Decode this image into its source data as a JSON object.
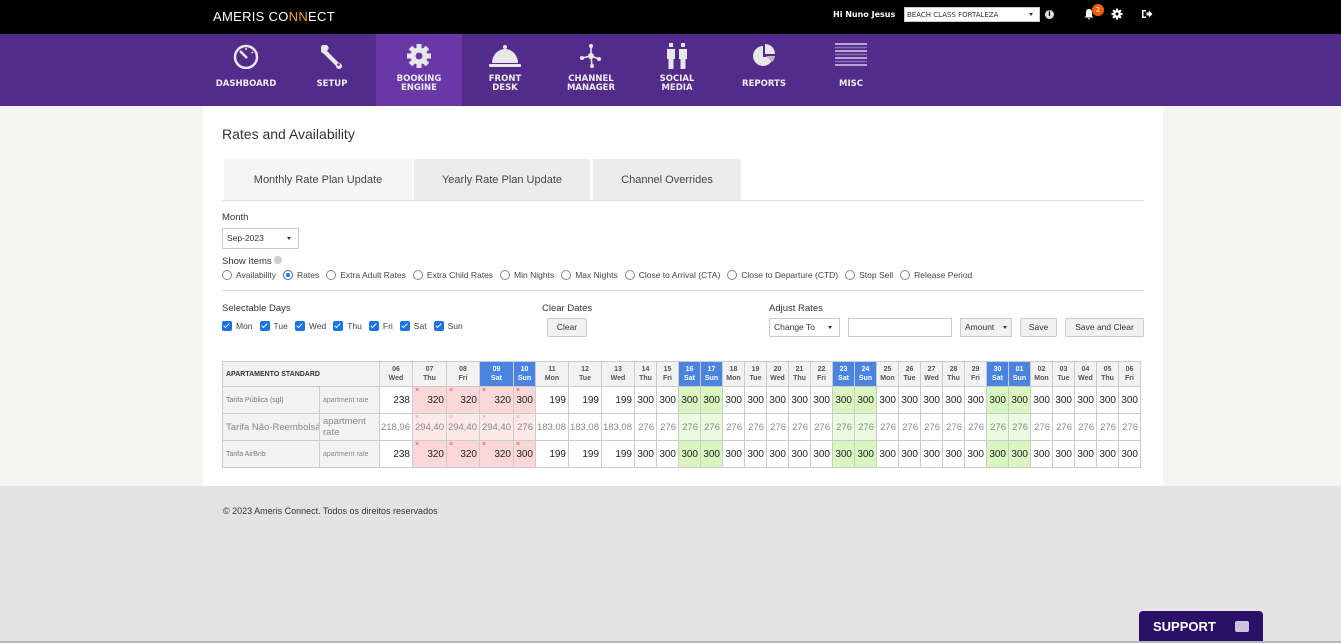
{
  "topbar": {
    "logo_a": "AMERIS CO",
    "logo_b": "NN",
    "logo_c": "ECT",
    "greeting": "Hi Nuno Jesus",
    "hotel": "BEACH CLASS FORTALEZA",
    "notification_count": "2"
  },
  "nav": [
    {
      "label1": "DASHBOARD",
      "label2": "",
      "icon": "dashboard-icon"
    },
    {
      "label1": "SETUP",
      "label2": "",
      "icon": "wrench-icon"
    },
    {
      "label1": "BOOKING",
      "label2": "ENGINE",
      "icon": "gear-icon",
      "active": true
    },
    {
      "label1": "FRONT",
      "label2": "DESK",
      "icon": "bell-icon"
    },
    {
      "label1": "CHANNEL",
      "label2": "MANAGER",
      "icon": "network-icon"
    },
    {
      "label1": "SOCIAL",
      "label2": "MEDIA",
      "icon": "people-icon"
    },
    {
      "label1": "REPORTS",
      "label2": "",
      "icon": "pie-chart-icon"
    },
    {
      "label1": "MISC",
      "label2": "",
      "icon": "menu-icon"
    }
  ],
  "page": {
    "title": "Rates and Availability",
    "tabs": [
      "Monthly Rate Plan Update",
      "Yearly Rate Plan Update",
      "Channel Overrides"
    ],
    "month_label": "Month",
    "month_value": "Sep-2023",
    "show_items_label": "Show Items",
    "show_items": [
      {
        "label": "Availability",
        "selected": false
      },
      {
        "label": "Rates",
        "selected": true
      },
      {
        "label": "Extra Adult Rates",
        "selected": false
      },
      {
        "label": "Extra Child Rates",
        "selected": false
      },
      {
        "label": "Min Nights",
        "selected": false
      },
      {
        "label": "Max Nights",
        "selected": false
      },
      {
        "label": "Close to Arrival (CTA)",
        "selected": false
      },
      {
        "label": "Close to Departure (CTD)",
        "selected": false
      },
      {
        "label": "Stop Sell",
        "selected": false
      },
      {
        "label": "Release Period",
        "selected": false
      }
    ],
    "selectable_days_label": "Selectable Days",
    "days": [
      "Mon",
      "Tue",
      "Wed",
      "Thu",
      "Fri",
      "Sat",
      "Sun"
    ],
    "clear_dates_label": "Clear Dates",
    "clear_button": "Clear",
    "adjust_rates_label": "Adjust Rates",
    "adjust_mode": "Change To",
    "adjust_value": "",
    "adjust_unit": "Amount",
    "save_button": "Save",
    "save_clear_button": "Save and Clear"
  },
  "grid": {
    "room": "APARTAMENTO STANDARD",
    "dates": [
      {
        "d": "06",
        "w": "Wed"
      },
      {
        "d": "07",
        "w": "Thu"
      },
      {
        "d": "08",
        "w": "Fri"
      },
      {
        "d": "09",
        "w": "Sat"
      },
      {
        "d": "10",
        "w": "Sun"
      },
      {
        "d": "11",
        "w": "Mon"
      },
      {
        "d": "12",
        "w": "Tue"
      },
      {
        "d": "13",
        "w": "Wed"
      },
      {
        "d": "14",
        "w": "Thu"
      },
      {
        "d": "15",
        "w": "Fri"
      },
      {
        "d": "16",
        "w": "Sat"
      },
      {
        "d": "17",
        "w": "Sun"
      },
      {
        "d": "18",
        "w": "Mon"
      },
      {
        "d": "19",
        "w": "Tue"
      },
      {
        "d": "20",
        "w": "Wed"
      },
      {
        "d": "21",
        "w": "Thu"
      },
      {
        "d": "22",
        "w": "Fri"
      },
      {
        "d": "23",
        "w": "Sat"
      },
      {
        "d": "24",
        "w": "Sun"
      },
      {
        "d": "25",
        "w": "Mon"
      },
      {
        "d": "26",
        "w": "Tue"
      },
      {
        "d": "27",
        "w": "Wed"
      },
      {
        "d": "28",
        "w": "Thu"
      },
      {
        "d": "29",
        "w": "Fri"
      },
      {
        "d": "30",
        "w": "Sat"
      },
      {
        "d": "01",
        "w": "Sun"
      },
      {
        "d": "02",
        "w": "Mon"
      },
      {
        "d": "03",
        "w": "Tue"
      },
      {
        "d": "04",
        "w": "Wed"
      },
      {
        "d": "05",
        "w": "Thu"
      },
      {
        "d": "06",
        "w": "Fri"
      }
    ],
    "closed_indices": [
      1,
      2,
      3,
      4
    ],
    "rows": [
      {
        "name": "Tarifa Pública (sgl)",
        "type": "apartment rate",
        "derived": false,
        "values": [
          "238",
          "320",
          "320",
          "320",
          "300",
          "199",
          "199",
          "199",
          "300",
          "300",
          "300",
          "300",
          "300",
          "300",
          "300",
          "300",
          "300",
          "300",
          "300",
          "300",
          "300",
          "300",
          "300",
          "300",
          "300",
          "300",
          "300",
          "300",
          "300",
          "300",
          "300"
        ]
      },
      {
        "name": "Tarifa Não-Reembolsável ...",
        "type": "apartment rate",
        "derived": true,
        "values": [
          "218,96",
          "294,40",
          "294,40",
          "294,40",
          "276",
          "183,08",
          "183,08",
          "183,08",
          "276",
          "276",
          "276",
          "276",
          "276",
          "276",
          "276",
          "276",
          "276",
          "276",
          "276",
          "276",
          "276",
          "276",
          "276",
          "276",
          "276",
          "276",
          "276",
          "276",
          "276",
          "276",
          "276"
        ]
      },
      {
        "name": "Tarifa AirBnb",
        "type": "apartment rate",
        "derived": false,
        "values": [
          "238",
          "320",
          "320",
          "320",
          "300",
          "199",
          "199",
          "199",
          "300",
          "300",
          "300",
          "300",
          "300",
          "300",
          "300",
          "300",
          "300",
          "300",
          "300",
          "300",
          "300",
          "300",
          "300",
          "300",
          "300",
          "300",
          "300",
          "300",
          "300",
          "300",
          "300"
        ]
      }
    ]
  },
  "footer": {
    "copyright": "© 2023 Ameris Connect. Todos os direitos reservados",
    "support": "SUPPORT"
  }
}
